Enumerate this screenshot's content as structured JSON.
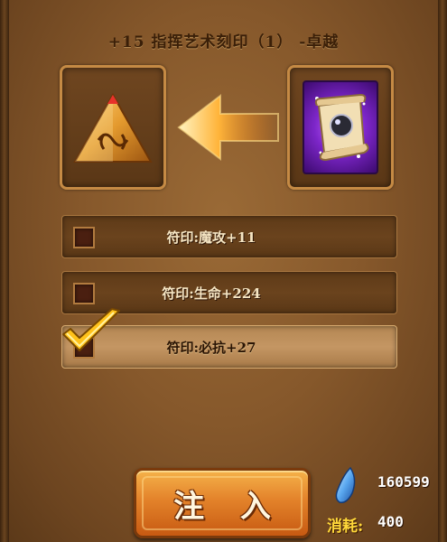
{
  "dialog": {
    "title": "+15 指挥艺术刻印（1） -卓越"
  },
  "slots": {
    "target_icon": "rune-pyramid-icon",
    "source_icon": "magic-scroll-icon",
    "arrow_icon": "arrow-left-icon"
  },
  "options": [
    {
      "label": "符印:魔攻+11",
      "checked": false
    },
    {
      "label": "符印:生命+224",
      "checked": false
    },
    {
      "label": "符印:必抗+27",
      "checked": true
    }
  ],
  "action": {
    "inject_label": "注 入"
  },
  "resources": {
    "gem_icon": "blue-gem-icon",
    "gem_count": "160599",
    "cost_label": "消耗:",
    "cost_value": "400"
  },
  "colors": {
    "panel": "#86582b",
    "button": "#e3822a",
    "check": "#ffc21a"
  }
}
